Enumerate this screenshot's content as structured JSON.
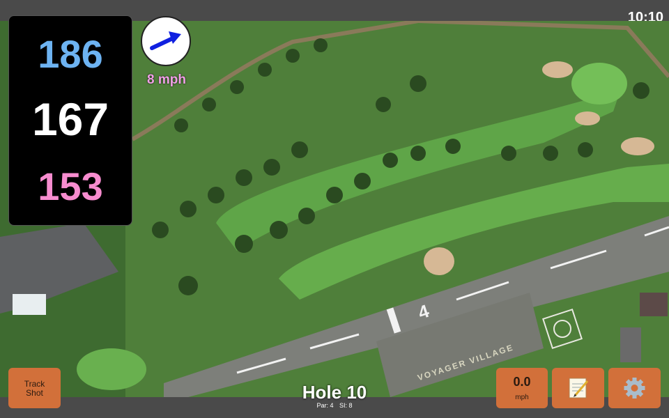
{
  "status": {
    "time": "10:10"
  },
  "distances": {
    "back": "186",
    "middle": "167",
    "front": "153"
  },
  "wind": {
    "speed": "8 mph",
    "direction_icon": "arrow-icon"
  },
  "buttons": {
    "track_shot_line1": "Track",
    "track_shot_line2": "Shot",
    "speed_value": "0.0",
    "speed_unit": "mph",
    "notes_icon": "notepad-icon",
    "settings_icon": "gear-icon"
  },
  "hole": {
    "title": "Hole 10",
    "par": "Par: 4",
    "si": "SI: 8"
  },
  "map": {
    "painted_text": "VOYAGER VILLAGE",
    "runway_number": "4"
  },
  "colors": {
    "back_distance": "#6db3f2",
    "middle_distance": "#ffffff",
    "front_distance": "#f78ccf",
    "button_bg": "#d2703a"
  }
}
